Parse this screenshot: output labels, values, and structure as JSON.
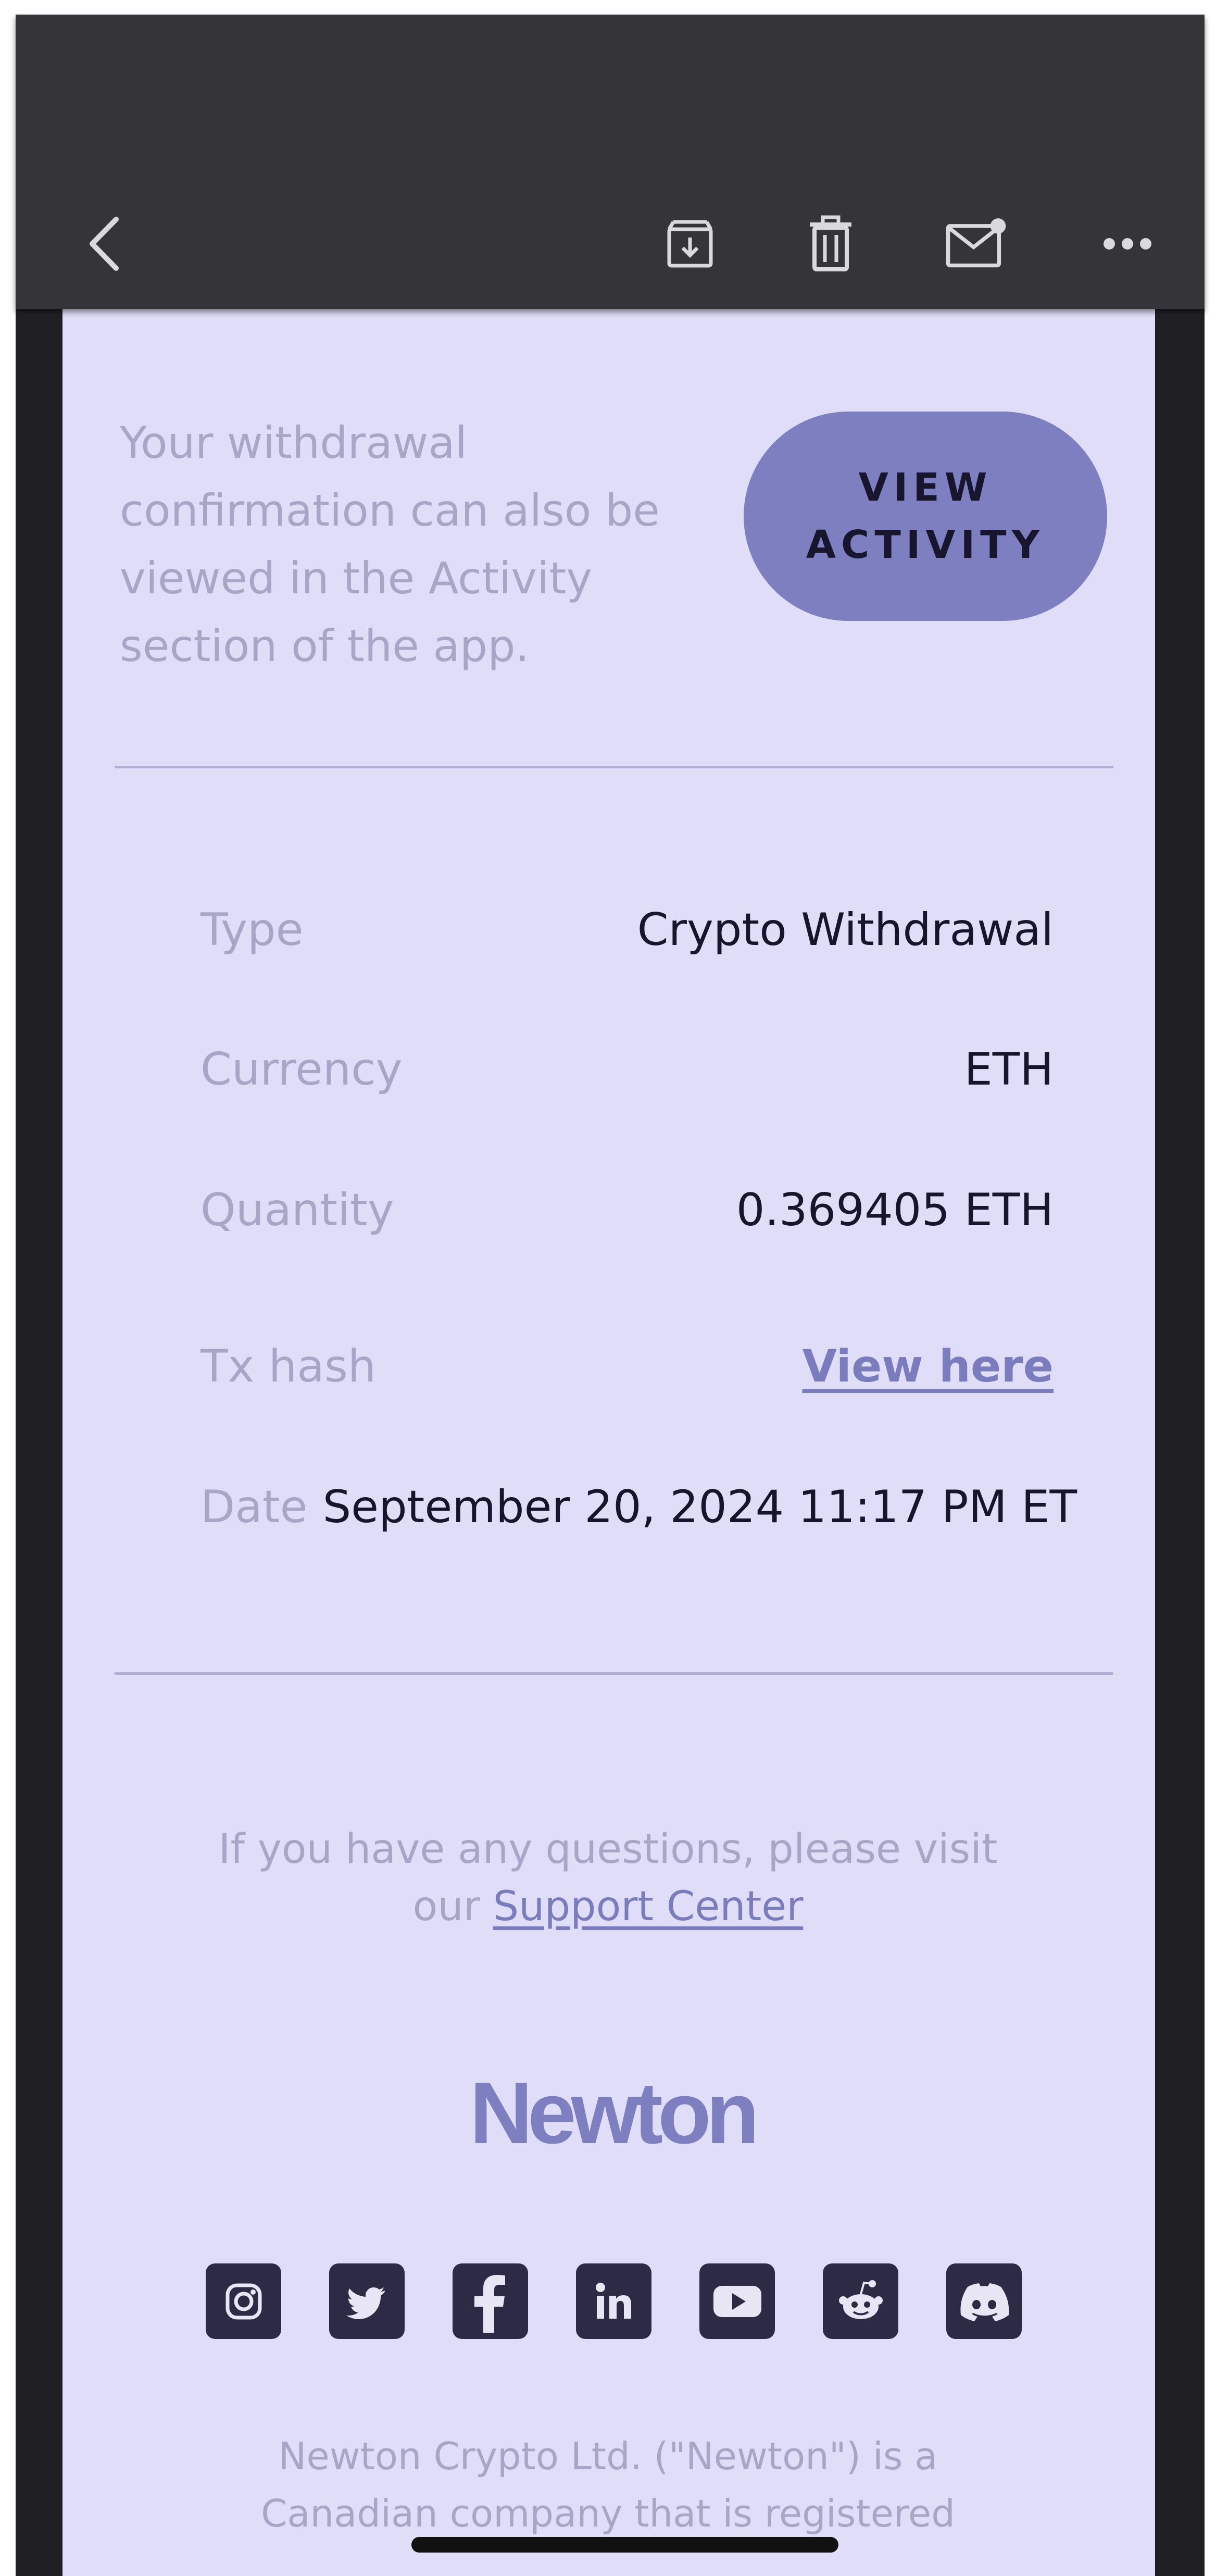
{
  "intro_text": "Your withdrawal confirmation can also be viewed in the Activity section of the app.",
  "view_activity_button": "VIEW\nACTIVITY",
  "details": [
    {
      "label": "Type",
      "value": "Crypto Withdrawal"
    },
    {
      "label": "Currency",
      "value": "ETH"
    },
    {
      "label": "Quantity",
      "value": "0.369405 ETH"
    },
    {
      "label": "Tx hash",
      "value": "View here"
    },
    {
      "label": "Date",
      "value": "September 20, 2024 11:17 PM ET"
    }
  ],
  "help": {
    "text_before": "If you have any questions, please visit our ",
    "link": "Support Center"
  },
  "logo_text": "Newton",
  "social_icons": [
    "instagram-icon",
    "twitter-icon",
    "facebook-icon",
    "linkedin-icon",
    "youtube-icon",
    "reddit-icon",
    "discord-icon"
  ],
  "legal_text": "Newton Crypto Ltd. (\"Newton\") is a\nCanadian company that is registered",
  "colors": {
    "toolbar": "#343439",
    "email_background": "#e0ddf8",
    "accent": "#7d7fc0",
    "muted_text": "#a9a5c7",
    "dark_text": "#17152b"
  }
}
